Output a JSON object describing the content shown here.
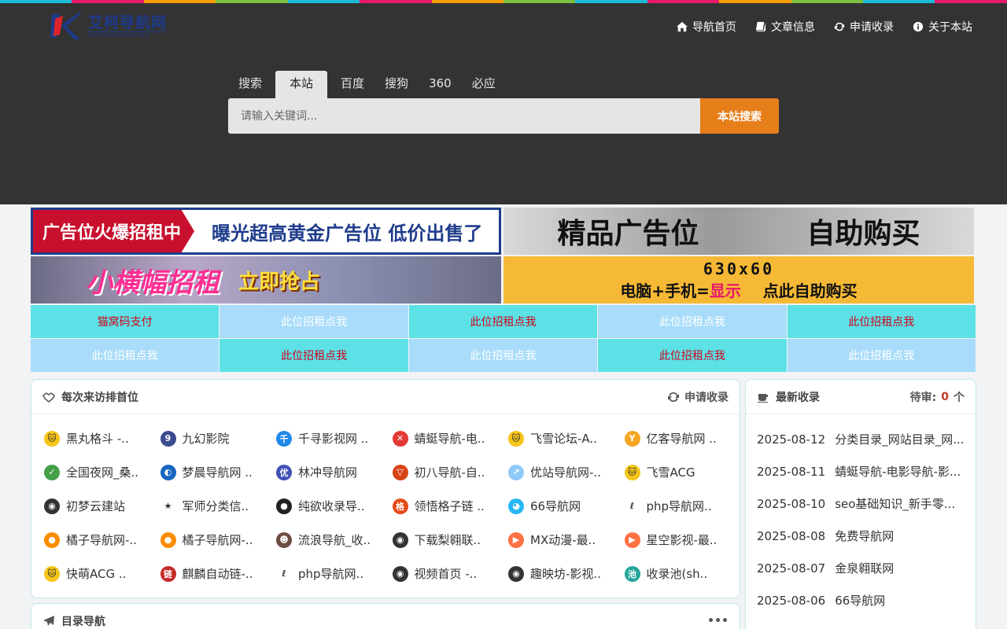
{
  "stripe_colors": [
    "#1cbbd6",
    "#e6196b",
    "#f59c00",
    "#7ac142",
    "#1cbbd6",
    "#e6196b",
    "#f59c00",
    "#7ac142",
    "#1cbbd6",
    "#e6196b",
    "#f59c00",
    "#7ac142",
    "#1cbbd6",
    "#e6196b"
  ],
  "brand": {
    "name": "艾柯导航网",
    "sub": "AIKEDAOHANGWANG"
  },
  "topnav": [
    {
      "label": "导航首页",
      "icon": "home-icon"
    },
    {
      "label": "文章信息",
      "icon": "book-icon"
    },
    {
      "label": "申请收录",
      "icon": "refresh-icon"
    },
    {
      "label": "关于本站",
      "icon": "info-icon"
    }
  ],
  "search": {
    "tabs": [
      "搜索",
      "本站",
      "百度",
      "搜狗",
      "360",
      "必应"
    ],
    "active_tab": "本站",
    "placeholder": "请输入关键词...",
    "button": "本站搜索"
  },
  "ads": {
    "ad1_red": "广告位火爆招租中",
    "ad1_blue": "曝光超高黄金广告位 低价出售了",
    "ad2_left": "精品广告位",
    "ad2_right": "自助购买",
    "ad3_t1": "小横幅招租",
    "ad3_t2": "立即抢占",
    "ad4_l1": "630x60",
    "ad4_l2a": "电脑+手机=",
    "ad4_l2b": "显示",
    "ad4_l2c": "点此自助购买"
  },
  "text_links": [
    "猫窝码支付",
    "此位招租点我",
    "此位招租点我",
    "此位招租点我",
    "此位招租点我",
    "此位招租点我",
    "此位招租点我",
    "此位招租点我",
    "此位招租点我",
    "此位招租点我"
  ],
  "rank": {
    "title": "每次来访排首位",
    "apply": "申请收录",
    "sites": [
      {
        "label": "黑丸格斗 -..",
        "color": "#f5c518",
        "glyph": "🐱"
      },
      {
        "label": "九幻影院",
        "color": "#3b4b8f",
        "glyph": "9"
      },
      {
        "label": "千寻影视网 ..",
        "color": "#1e88e5",
        "glyph": "千"
      },
      {
        "label": "蜻蜓导航-电..",
        "color": "#e53935",
        "glyph": "✕"
      },
      {
        "label": "飞雪论坛-A..",
        "color": "#f5c518",
        "glyph": "🐱"
      },
      {
        "label": "亿客导航网 ..",
        "color": "#f5a623",
        "glyph": "Y"
      },
      {
        "label": "全国夜网_桑..",
        "color": "#43a047",
        "glyph": "✓"
      },
      {
        "label": "梦晨导航网 ..",
        "color": "#1565c0",
        "glyph": "◐"
      },
      {
        "label": "林冲导航网",
        "color": "#3f51b5",
        "glyph": "优"
      },
      {
        "label": "初八导航-自..",
        "color": "#d84315",
        "glyph": "▽"
      },
      {
        "label": "优站导航网-..",
        "color": "#90caf9",
        "glyph": "↗"
      },
      {
        "label": "飞雪ACG",
        "color": "#f5c518",
        "glyph": "🐱"
      },
      {
        "label": "初梦云建站",
        "color": "#333333",
        "glyph": "◉"
      },
      {
        "label": "军师分类信..",
        "color": "#ffffff",
        "glyph": "★"
      },
      {
        "label": "纯欲收录导..",
        "color": "#222222",
        "glyph": "●"
      },
      {
        "label": "领悟格子链 ..",
        "color": "#e64a19",
        "glyph": "格"
      },
      {
        "label": "66导航网",
        "color": "#29b6f6",
        "glyph": "◕"
      },
      {
        "label": "php导航网..",
        "color": "#ffffff",
        "glyph": "ℓ"
      },
      {
        "label": "橘子导航网-..",
        "color": "#fb8c00",
        "glyph": "●"
      },
      {
        "label": "橘子导航网-..",
        "color": "#fb8c00",
        "glyph": "●"
      },
      {
        "label": "流浪导航_收..",
        "color": "#6d4c41",
        "glyph": "☻"
      },
      {
        "label": "下载梨翱联..",
        "color": "#333333",
        "glyph": "◉"
      },
      {
        "label": "MX动漫-最..",
        "color": "#ff7043",
        "glyph": "▶"
      },
      {
        "label": "星空影视-最..",
        "color": "#ff7043",
        "glyph": "▶"
      },
      {
        "label": "快萌ACG ..",
        "color": "#f5c518",
        "glyph": "🐱"
      },
      {
        "label": "麒麟自动链-..",
        "color": "#c62828",
        "glyph": "链"
      },
      {
        "label": "php导航网..",
        "color": "#ffffff",
        "glyph": "ℓ"
      },
      {
        "label": "视频首页 -..",
        "color": "#333333",
        "glyph": "◉"
      },
      {
        "label": "趣映坊-影视..",
        "color": "#333333",
        "glyph": "◉"
      },
      {
        "label": "收录池(sh..",
        "color": "#26a69a",
        "glyph": "池"
      }
    ]
  },
  "recent": {
    "title": "最新收录",
    "pending_label": "待审:",
    "pending_count": "0",
    "pending_unit": "个",
    "items": [
      {
        "date": "2025-08-12",
        "name": "分类目录_网站目录_网..."
      },
      {
        "date": "2025-08-11",
        "name": "蜻蜓导航-电影导航-影..."
      },
      {
        "date": "2025-08-10",
        "name": "seo基础知识_新手零..."
      },
      {
        "date": "2025-08-08",
        "name": "免费导航网"
      },
      {
        "date": "2025-08-07",
        "name": "金泉翱联网"
      },
      {
        "date": "2025-08-06",
        "name": "66导航网"
      }
    ]
  },
  "directory": {
    "title": "目录导航",
    "more": "•••"
  }
}
